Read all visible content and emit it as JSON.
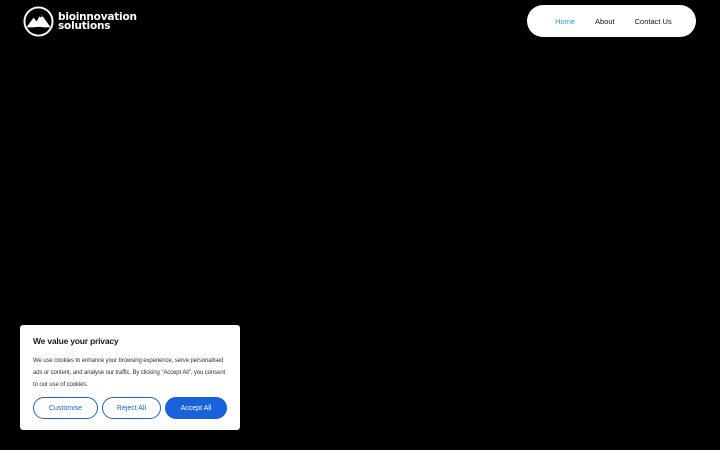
{
  "brand": {
    "line1": "bioinnovation",
    "line2": "solutions",
    "logo_icon": "mountain-circle-logo-icon"
  },
  "nav": {
    "items": [
      {
        "label": "Home",
        "active": true
      },
      {
        "label": "About",
        "active": false
      },
      {
        "label": "Contact Us",
        "active": false
      }
    ],
    "active_color": "#2e9bd6"
  },
  "cookie_banner": {
    "title": "We value your privacy",
    "body": "We use cookies to enhance your browsing experience, serve personalised ads or content, and analyse our traffic. By clicking \"Accept All\", you consent to our use of cookies.",
    "buttons": {
      "customise": "Customise",
      "reject": "Reject All",
      "accept": "Accept All"
    },
    "accent_color": "#1863dc"
  }
}
